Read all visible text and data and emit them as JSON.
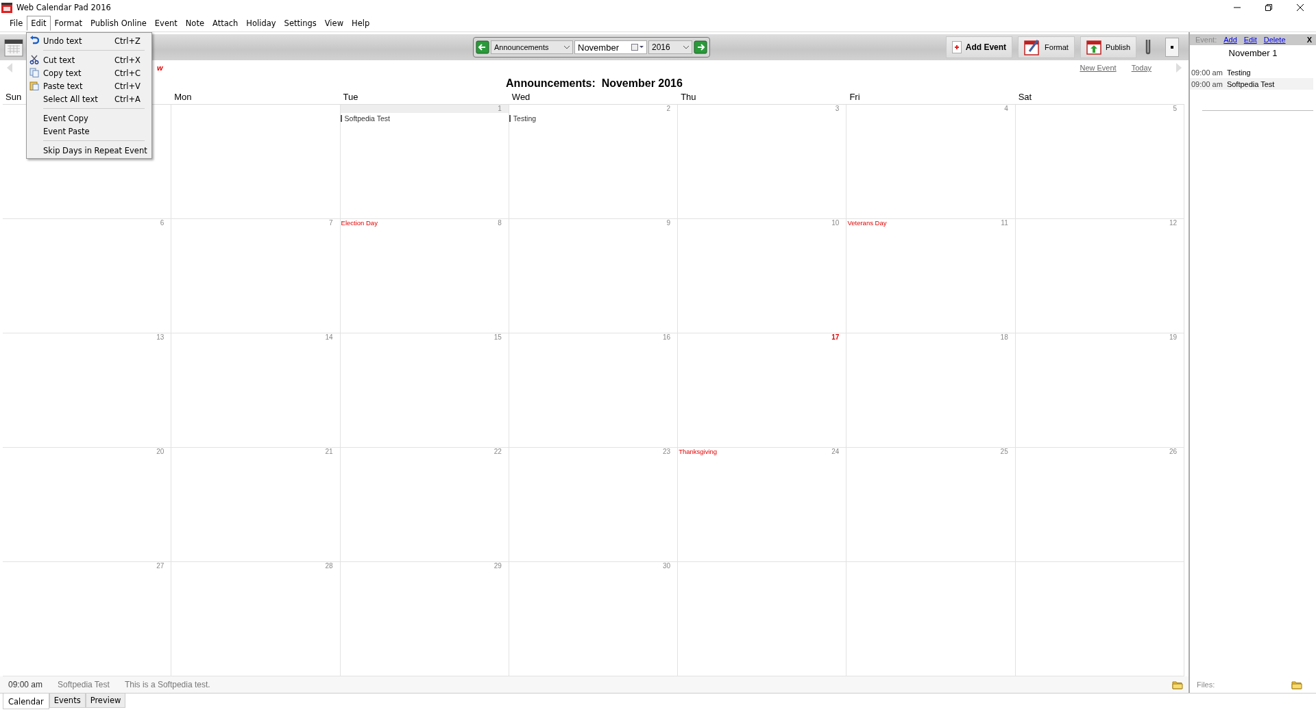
{
  "window": {
    "title": "Web Calendar Pad 2016"
  },
  "menu": [
    {
      "label": "File",
      "selected": false
    },
    {
      "label": "Edit",
      "selected": true
    },
    {
      "label": "Format",
      "selected": false
    },
    {
      "label": "Publish Online",
      "selected": false
    },
    {
      "label": "Event",
      "selected": false
    },
    {
      "label": "Note",
      "selected": false
    },
    {
      "label": "Attach",
      "selected": false
    },
    {
      "label": "Holiday",
      "selected": false
    },
    {
      "label": "Settings",
      "selected": false
    },
    {
      "label": "View",
      "selected": false
    },
    {
      "label": "Help",
      "selected": false
    }
  ],
  "edit_menu": [
    {
      "kind": "item",
      "label": "Undo text",
      "shortcut": "Ctrl+Z"
    },
    {
      "kind": "separator"
    },
    {
      "kind": "item",
      "label": "Cut text",
      "shortcut": "Ctrl+X"
    },
    {
      "kind": "item",
      "label": "Copy text",
      "shortcut": "Ctrl+C"
    },
    {
      "kind": "item",
      "label": "Paste text",
      "shortcut": "Ctrl+V"
    },
    {
      "kind": "item",
      "label": "Select All text",
      "shortcut": "Ctrl+A"
    },
    {
      "kind": "separator"
    },
    {
      "kind": "item",
      "label": "Event Copy"
    },
    {
      "kind": "item",
      "label": "Event Paste"
    },
    {
      "kind": "separator"
    },
    {
      "kind": "item",
      "label": "Skip Days in Repeat Event"
    }
  ],
  "toolbar": {
    "calendar": "Announcements",
    "month": "November",
    "year": "2016",
    "buttons": [
      "Add Event",
      "Format",
      "Publish"
    ]
  },
  "nav": {
    "cut_text": "w",
    "links": [
      "New Event",
      "Today"
    ]
  },
  "calendar": {
    "title": "Announcements:  November 2016",
    "weekdays": [
      "Sun",
      "Mon",
      "Tue",
      "Wed",
      "Thu",
      "Fri",
      "Sat"
    ],
    "weeks": [
      [
        {
          "kind": "blank"
        },
        {
          "kind": "blank"
        },
        {
          "kind": "day",
          "day": "1",
          "selected": true,
          "today": false,
          "events": [
            "Softpedia Test"
          ]
        },
        {
          "kind": "day",
          "day": "2",
          "selected": false,
          "today": false,
          "events": [
            "Testing"
          ]
        },
        {
          "kind": "day",
          "day": "3",
          "selected": false,
          "today": false
        },
        {
          "kind": "day",
          "day": "4",
          "selected": false,
          "today": false
        },
        {
          "kind": "day",
          "day": "5",
          "selected": false,
          "today": false
        }
      ],
      [
        {
          "kind": "day",
          "day": "6",
          "selected": false,
          "today": false
        },
        {
          "kind": "day",
          "day": "7",
          "selected": false,
          "today": false
        },
        {
          "kind": "day",
          "day": "8",
          "selected": false,
          "today": false,
          "holiday": "Election Day"
        },
        {
          "kind": "day",
          "day": "9",
          "selected": false,
          "today": false
        },
        {
          "kind": "day",
          "day": "10",
          "selected": false,
          "today": false
        },
        {
          "kind": "day",
          "day": "11",
          "selected": false,
          "today": false,
          "holiday": "Veterans Day"
        },
        {
          "kind": "day",
          "day": "12",
          "selected": false,
          "today": false
        }
      ],
      [
        {
          "kind": "day",
          "day": "13",
          "selected": false,
          "today": false
        },
        {
          "kind": "day",
          "day": "14",
          "selected": false,
          "today": false
        },
        {
          "kind": "day",
          "day": "15",
          "selected": false,
          "today": false
        },
        {
          "kind": "day",
          "day": "16",
          "selected": false,
          "today": false
        },
        {
          "kind": "day",
          "day": "17",
          "selected": false,
          "today": true
        },
        {
          "kind": "day",
          "day": "18",
          "selected": false,
          "today": false
        },
        {
          "kind": "day",
          "day": "19",
          "selected": false,
          "today": false
        }
      ],
      [
        {
          "kind": "day",
          "day": "20",
          "selected": false,
          "today": false
        },
        {
          "kind": "day",
          "day": "21",
          "selected": false,
          "today": false
        },
        {
          "kind": "day",
          "day": "22",
          "selected": false,
          "today": false
        },
        {
          "kind": "day",
          "day": "23",
          "selected": false,
          "today": false
        },
        {
          "kind": "day",
          "day": "24",
          "selected": false,
          "today": false,
          "holiday": "Thanksgiving"
        },
        {
          "kind": "day",
          "day": "25",
          "selected": false,
          "today": false
        },
        {
          "kind": "day",
          "day": "26",
          "selected": false,
          "today": false
        }
      ],
      [
        {
          "kind": "day",
          "day": "27",
          "selected": false,
          "today": false
        },
        {
          "kind": "day",
          "day": "28",
          "selected": false,
          "today": false
        },
        {
          "kind": "day",
          "day": "29",
          "selected": false,
          "today": false
        },
        {
          "kind": "day",
          "day": "30",
          "selected": false,
          "today": false
        },
        {
          "kind": "blank"
        },
        {
          "kind": "blank"
        },
        {
          "kind": "blank"
        }
      ]
    ]
  },
  "status": {
    "time": "09:00 am",
    "title": "Softpedia Test",
    "description": "This is a Softpedia test."
  },
  "side_panel": {
    "label": "Event:",
    "actions": [
      "Add",
      "Edit",
      "Delete"
    ],
    "close": "X",
    "date": "November 1",
    "events": [
      {
        "time": "09:00 am",
        "title": "Testing",
        "selected": false
      },
      {
        "time": "09:00 am",
        "title": "Softpedia Test",
        "selected": true
      }
    ],
    "files_label": "Files:"
  },
  "tabs": [
    {
      "label": "Calendar",
      "selected": true
    },
    {
      "label": "Events",
      "selected": false
    },
    {
      "label": "Preview",
      "selected": false
    }
  ]
}
